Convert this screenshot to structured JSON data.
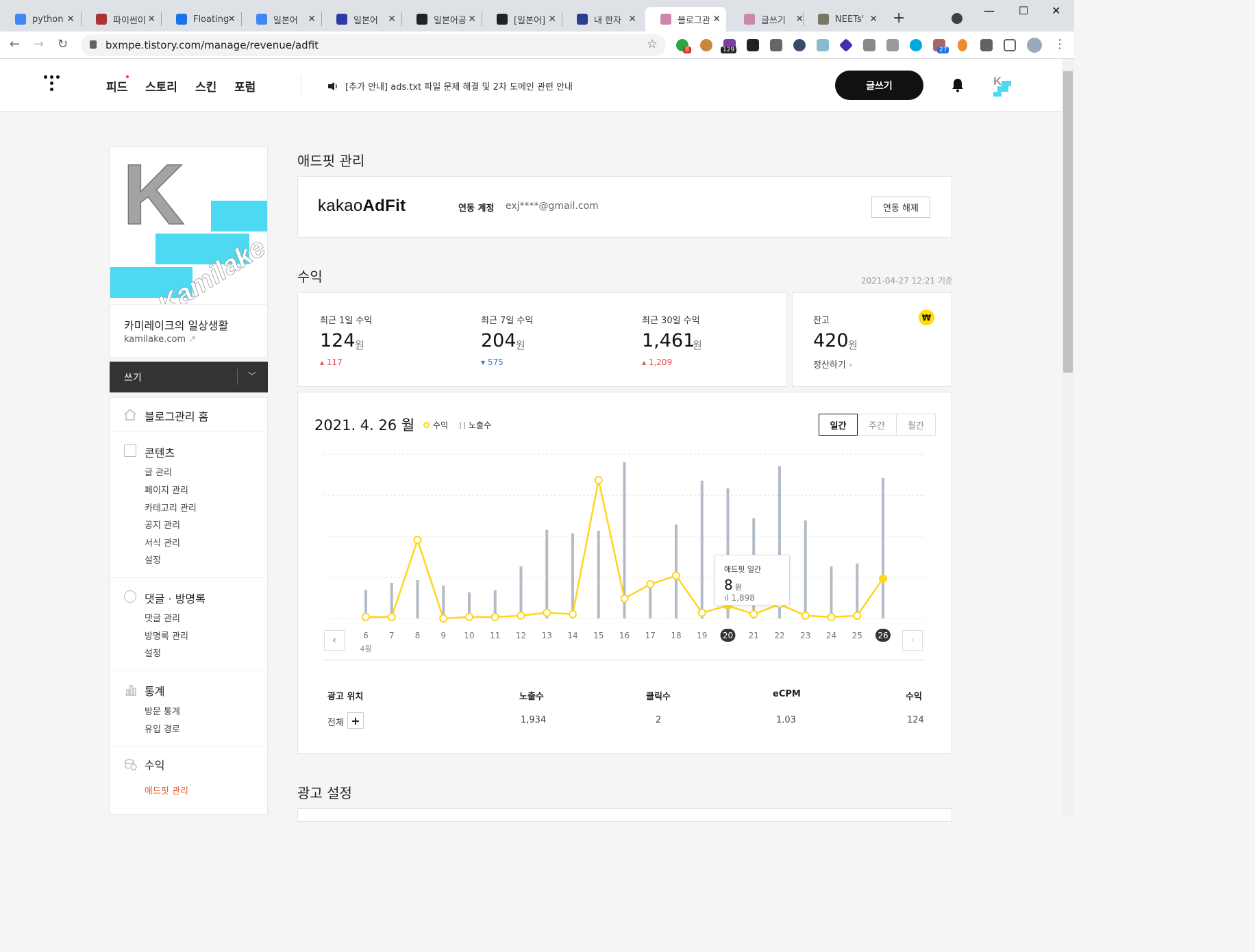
{
  "browser": {
    "tabs": [
      {
        "title": "python",
        "icon": "google-icon",
        "color": "#4285f4"
      },
      {
        "title": "파이썬이",
        "icon": "blog-icon",
        "color": "#a33"
      },
      {
        "title": "Floating",
        "icon": "floating-icon",
        "color": "#1a73e8"
      },
      {
        "title": "일본어",
        "icon": "google-icon",
        "color": "#4285f4"
      },
      {
        "title": "일본어",
        "icon": "cube-icon",
        "color": "#2f3aa8"
      },
      {
        "title": "일본어공",
        "icon": "tistory-icon",
        "color": "#222"
      },
      {
        "title": "[일본어]",
        "icon": "tistory-icon",
        "color": "#222"
      },
      {
        "title": "내 한자",
        "icon": "app-icon",
        "color": "#2a3d8f"
      },
      {
        "title": "블로그관",
        "icon": "blog-icon",
        "color": "#c8a"
      },
      {
        "title": "글쓰기",
        "icon": "blog-icon",
        "color": "#c8a"
      },
      {
        "title": "NEETs'",
        "icon": "avatar-icon",
        "color": "#776"
      }
    ],
    "url": "bxmpe.tistory.com/manage/revenue/adfit",
    "ext_badges": [
      "8",
      "129",
      "27"
    ]
  },
  "header": {
    "nav": [
      "피드",
      "스토리",
      "스킨",
      "포럼"
    ],
    "notice": "[추가 안내] ads.txt 파일 문제 해결 및 2차 도메인 관련 안내",
    "write_label": "글쓰기"
  },
  "sidebar": {
    "blog_name": "카미레이크의 일상생활",
    "blog_url": "kamilake.com",
    "logo_letter": "K",
    "logo_text": "Kamilake",
    "write_label": "쓰기",
    "home_label": "블로그관리 홈",
    "sections": [
      {
        "title": "콘텐츠",
        "items": [
          "글 관리",
          "페이지 관리",
          "카테고리 관리",
          "공지 관리",
          "서식 관리",
          "설정"
        ]
      },
      {
        "title": "댓글 · 방명록",
        "items": [
          "댓글 관리",
          "방명록 관리",
          "설정"
        ]
      },
      {
        "title": "통계",
        "items": [
          "방문 통계",
          "유입 경로"
        ]
      },
      {
        "title": "수익",
        "items": [
          "애드핏 관리"
        ]
      }
    ]
  },
  "main": {
    "title": "애드핏 관리",
    "adfit": {
      "logo_light": "kakao",
      "logo_bold": "AdFit",
      "account_label": "연동 계정",
      "email": "exj****@gmail.com",
      "unlink_label": "연동 해제"
    },
    "revenue_title": "수익",
    "as_of": "2021-04-27 12:21 기준",
    "stats": [
      {
        "label": "최근 1일 수익",
        "value": "124",
        "unit": "원",
        "delta": "117",
        "dir": "up"
      },
      {
        "label": "최근 7일 수익",
        "value": "204",
        "unit": "원",
        "delta": "575",
        "dir": "down"
      },
      {
        "label": "최근 30일 수익",
        "value": "1,461",
        "unit": "원",
        "delta": "1,209",
        "dir": "up"
      }
    ],
    "balance": {
      "label": "잔고",
      "value": "420",
      "unit": "원",
      "settle_label": "정산하기",
      "icon": "won-icon",
      "icon_text": "₩"
    },
    "chart_header": {
      "date": "2021. 4. 26 월",
      "legend_revenue": "수익",
      "legend_impressions": "노출수",
      "periods": [
        "일간",
        "주간",
        "월간"
      ],
      "active_period": "일간"
    },
    "tooltip": {
      "title": "애드핏 일간",
      "value": "8",
      "unit": "원",
      "impressions": "1,898"
    },
    "table": {
      "headers": [
        "광고 위치",
        "노출수",
        "클릭수",
        "eCPM",
        "수익"
      ],
      "row": {
        "position": "전체",
        "impressions": "1,934",
        "clicks": "2",
        "ecpm": "1.03",
        "revenue": "124"
      }
    },
    "ad_settings_title": "광고 설정"
  },
  "chart_data": {
    "type": "bar",
    "x_label_month": "4월",
    "categories": [
      "6",
      "7",
      "8",
      "9",
      "10",
      "11",
      "12",
      "13",
      "14",
      "15",
      "16",
      "17",
      "18",
      "19",
      "20",
      "21",
      "22",
      "23",
      "24",
      "25",
      "26"
    ],
    "highlighted": [
      "20",
      "26"
    ],
    "series": [
      {
        "name": "노출수",
        "type": "bar",
        "color": "#b3bcc6",
        "values": [
          420,
          520,
          560,
          480,
          380,
          410,
          760,
          1290,
          1240,
          1280,
          2280,
          440,
          1370,
          2010,
          1898,
          1460,
          2220,
          1430,
          760,
          800,
          2050
        ]
      },
      {
        "name": "수익",
        "type": "line",
        "color": "#ffd51a",
        "values": [
          0,
          0,
          54,
          -1,
          0,
          0,
          1,
          3,
          2,
          96,
          13,
          23,
          29,
          3,
          8,
          2,
          9,
          1,
          0,
          1,
          27
        ]
      }
    ]
  }
}
